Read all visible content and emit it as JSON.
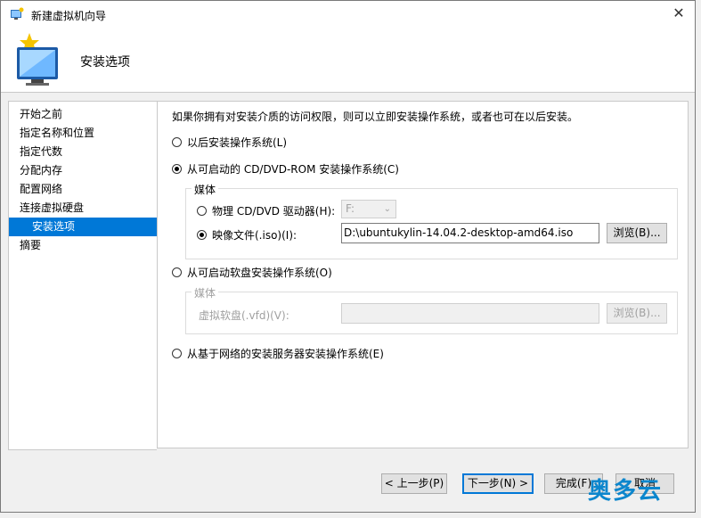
{
  "window": {
    "title": "新建虚拟机向导",
    "close_glyph": "✕"
  },
  "header": {
    "title": "安装选项"
  },
  "nav": {
    "items": [
      {
        "label": "开始之前"
      },
      {
        "label": "指定名称和位置"
      },
      {
        "label": "指定代数"
      },
      {
        "label": "分配内存"
      },
      {
        "label": "配置网络"
      },
      {
        "label": "连接虚拟硬盘"
      },
      {
        "label": "安装选项"
      },
      {
        "label": "摘要"
      }
    ]
  },
  "content": {
    "description": "如果你拥有对安装介质的访问权限，则可以立即安装操作系统，或者也可在以后安装。",
    "option_later": "以后安装操作系统(L)",
    "option_cd": "从可启动的 CD/DVD-ROM 安装操作系统(C)",
    "media_group_label": "媒体",
    "physical_drive_label": "物理 CD/DVD 驱动器(H):",
    "physical_drive_value": "F:",
    "image_file_label": "映像文件(.iso)(I):",
    "image_file_value": "D:\\ubuntukylin-14.04.2-desktop-amd64.iso",
    "browse_label": "浏览(B)...",
    "option_floppy": "从可启动软盘安装操作系统(O)",
    "floppy_group_label": "媒体",
    "virtual_floppy_label": "虚拟软盘(.vfd)(V):",
    "floppy_browse_label": "浏览(B)...",
    "option_network": "从基于网络的安装服务器安装操作系统(E)"
  },
  "footer": {
    "prev_label": "< 上一步(P)",
    "next_label": "下一步(N) >",
    "finish_label": "完成(F)",
    "cancel_label": "取消"
  },
  "watermark": "奥多云",
  "colors": {
    "selection": "#0078d7",
    "watermark": "#0c86cd"
  }
}
